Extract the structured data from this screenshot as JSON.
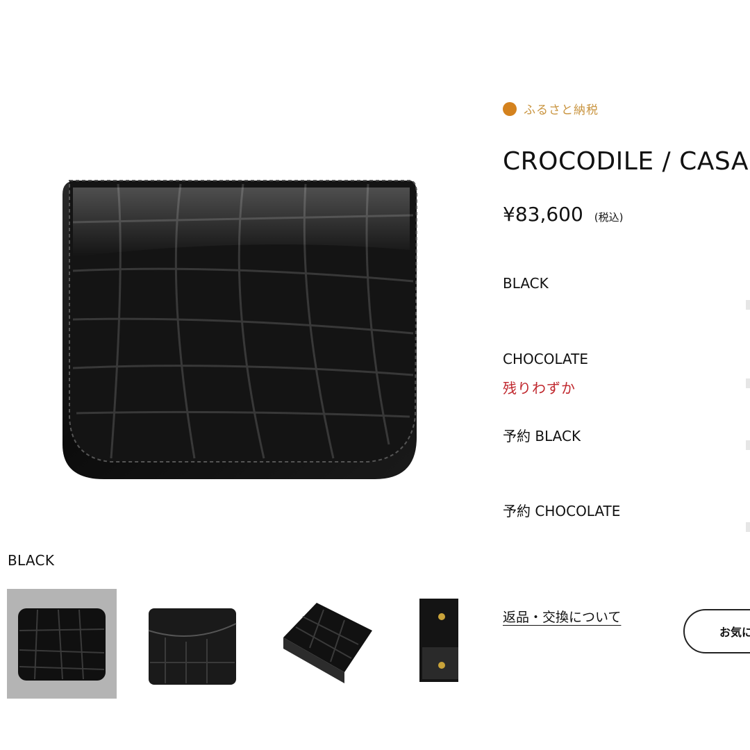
{
  "main_image": {
    "alt": "Crocodile leather wallet, black"
  },
  "gallery": {
    "caption": "BLACK",
    "thumbnails": [
      {
        "name": "front",
        "selected": true
      },
      {
        "name": "back",
        "selected": false
      },
      {
        "name": "angle",
        "selected": false
      },
      {
        "name": "open",
        "selected": false
      }
    ]
  },
  "badge": {
    "label": "ふるさと納税",
    "color": "#d4821e"
  },
  "product": {
    "title": "CROCODILE / CASA",
    "price": "¥83,600",
    "tax_note": "(税込)"
  },
  "options": [
    {
      "label": "BLACK"
    },
    {
      "label": "CHOCOLATE",
      "note": "残りわずか"
    },
    {
      "label": "予約 BLACK"
    },
    {
      "label": "予約 CHOCOLATE"
    }
  ],
  "returns_link": "返品・交換について",
  "favorite_button": "お気に入り"
}
